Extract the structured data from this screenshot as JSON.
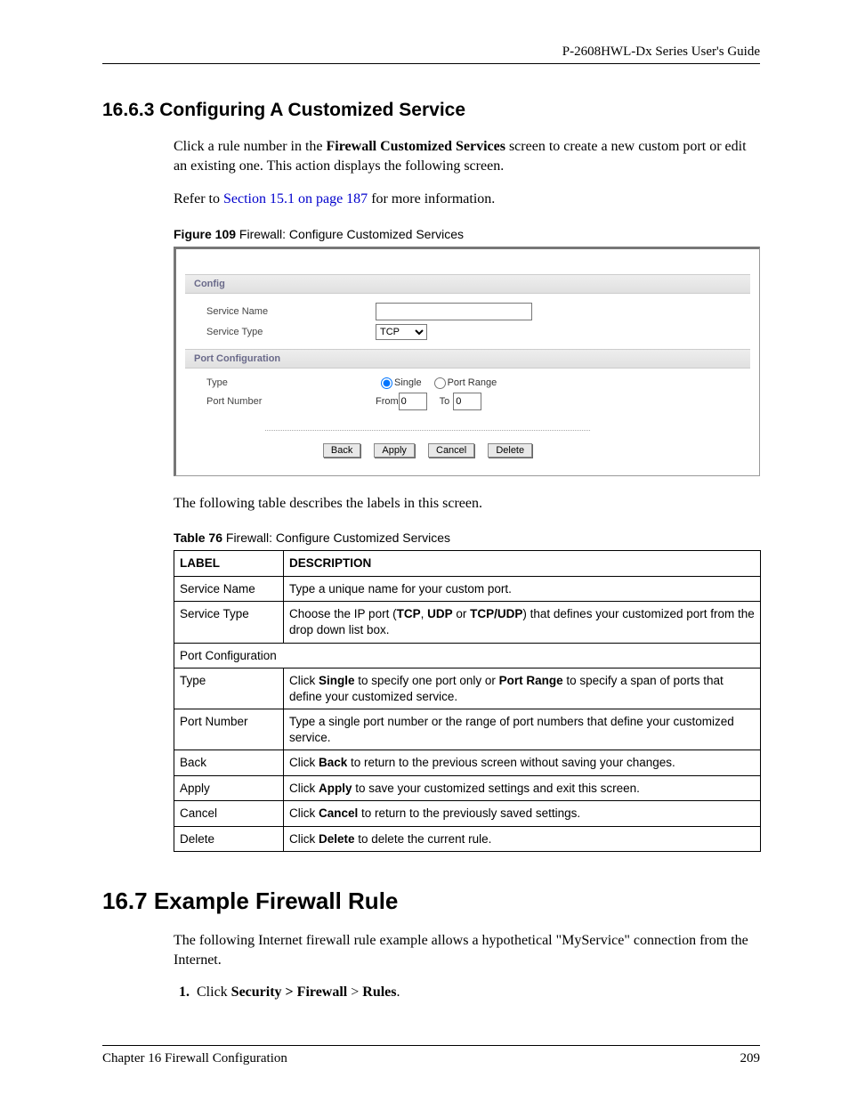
{
  "header": {
    "guide": "P-2608HWL-Dx Series User's Guide"
  },
  "sec1": {
    "num_title": "16.6.3  Configuring A Customized Service",
    "p1a": "Click a rule number in the ",
    "p1b": "Firewall Customized Services",
    "p1c": " screen to create a new custom port or edit an existing one. This action displays the following screen.",
    "p2a": "Refer to ",
    "p2link": "Section 15.1 on page 187",
    "p2b": " for more information."
  },
  "fig": {
    "cap_b": "Figure 109",
    "cap_t": "   Firewall: Configure Customized Services",
    "head1": "Config",
    "l_name": "Service Name",
    "l_type": "Service Type",
    "sel_type": "TCP",
    "head2": "Port Configuration",
    "l_ptype": "Type",
    "r_single": "Single",
    "r_range": "Port Range",
    "l_pnum": "Port Number",
    "from": "From",
    "to": "To",
    "v_from": "0",
    "v_to": "0",
    "b_back": "Back",
    "b_apply": "Apply",
    "b_cancel": "Cancel",
    "b_delete": "Delete"
  },
  "mid": "The following table describes the labels in this screen.",
  "tbl": {
    "cap_b": "Table 76",
    "cap_t": "   Firewall: Configure Customized Services",
    "h1": "LABEL",
    "h2": "DESCRIPTION",
    "r1a": "Service Name",
    "r1b": "Type a unique name for your custom port.",
    "r2a": "Service Type",
    "r2b1": "Choose the IP port (",
    "r2b2": "TCP",
    "r2b3": ", ",
    "r2b4": "UDP",
    "r2b5": " or ",
    "r2b6": "TCP/UDP",
    "r2b7": ") that defines your customized port from the drop down list box.",
    "r3": "Port Configuration",
    "r4a": "Type",
    "r4b1": "Click ",
    "r4b2": "Single",
    "r4b3": " to specify one port only or ",
    "r4b4": "Port Range",
    "r4b5": " to specify a span of ports that define your customized service.",
    "r5a": "Port Number",
    "r5b": "Type a single port number or the range of port numbers that define your customized service.",
    "r6a": "Back",
    "r6b1": "Click ",
    "r6b2": "Back",
    "r6b3": " to return to the previous screen without saving your changes.",
    "r7a": "Apply",
    "r7b1": "Click ",
    "r7b2": "Apply",
    "r7b3": " to save your customized settings and exit this screen.",
    "r8a": "Cancel",
    "r8b1": "Click ",
    "r8b2": "Cancel",
    "r8b3": " to return to the previously saved settings.",
    "r9a": "Delete",
    "r9b1": "Click ",
    "r9b2": "Delete",
    "r9b3": " to delete the current rule."
  },
  "sec2": {
    "num_title": "16.7  Example Firewall Rule",
    "p1": "The following Internet firewall rule example allows a hypothetical \"MyService\" connection from the Internet.",
    "s1a": "Click ",
    "s1b": "Security > Firewall",
    "s1c": " > ",
    "s1d": "Rules",
    "s1e": "."
  },
  "footer": {
    "left": "Chapter 16 Firewall Configuration",
    "right": "209"
  }
}
